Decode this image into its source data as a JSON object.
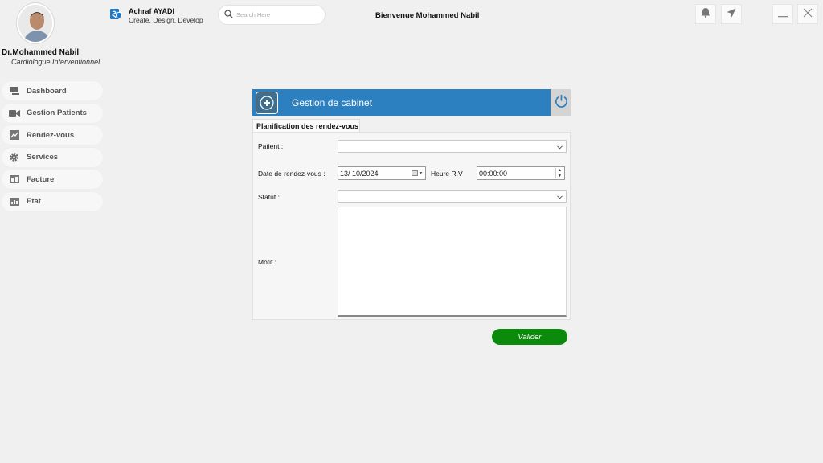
{
  "profile": {
    "name": "Dr.Mohammed Nabil",
    "title": "Cardiologue Interventionnel"
  },
  "sidebar": {
    "items": [
      {
        "label": "Dashboard",
        "icon": "dashboard-icon"
      },
      {
        "label": "Gestion Patients",
        "icon": "video-camera-icon"
      },
      {
        "label": "Rendez-vous",
        "icon": "chart-icon"
      },
      {
        "label": "Services",
        "icon": "gear-icon"
      },
      {
        "label": "Facture",
        "icon": "invoice-icon"
      },
      {
        "label": "Etat",
        "icon": "report-icon"
      }
    ]
  },
  "header": {
    "brand_name": "Achraf AYADI",
    "brand_tagline": "Create, Design, Develop",
    "search_placeholder": "Search Here",
    "welcome": "Bienvenue Mohammed Nabil"
  },
  "panel": {
    "title": "Gestion de cabinet",
    "tab_label": "Planification des rendez-vous",
    "accent_color": "#2c80bf"
  },
  "form": {
    "patient_label": "Patient :",
    "patient_value": "",
    "date_label": "Date de rendez-vous :",
    "date_value": "13/ 10/2024",
    "time_label": "Heure R.V",
    "time_value": "00:00:00",
    "statut_label": "Statut :",
    "statut_value": "",
    "motif_label": "Motif :",
    "motif_value": "",
    "submit_label": "Valider",
    "submit_color": "#0c8a0c"
  }
}
